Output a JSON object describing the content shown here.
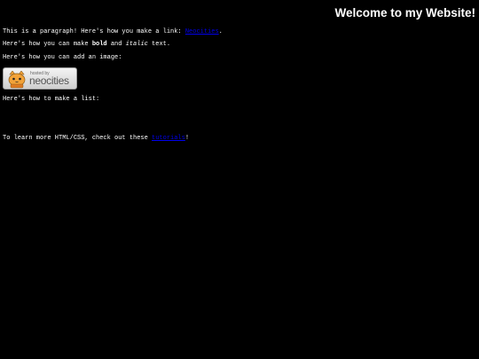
{
  "header": {
    "title": "Welcome to my Website!"
  },
  "paragraphs": {
    "link_intro": "This is a paragraph! Here's how you make a link: ",
    "link_text": "Neocities",
    "link_end": ".",
    "bold_intro": "Here's how you can make ",
    "bold_text": "bold",
    "bold_mid": " and ",
    "italic_text": "italic",
    "bold_end": " text.",
    "image_intro": "Here's how you can add an image:",
    "list_intro": "Here's how to make a list:",
    "learn_intro": "To learn more HTML/CSS, check out these ",
    "learn_link": "tutorials",
    "learn_end": "!"
  },
  "badge": {
    "small_text": "hosted by",
    "big_text": "neocities",
    "icon": "neocities-cat-icon"
  },
  "colors": {
    "background": "#000000",
    "text": "#ffffff",
    "link": "#0000ee"
  }
}
